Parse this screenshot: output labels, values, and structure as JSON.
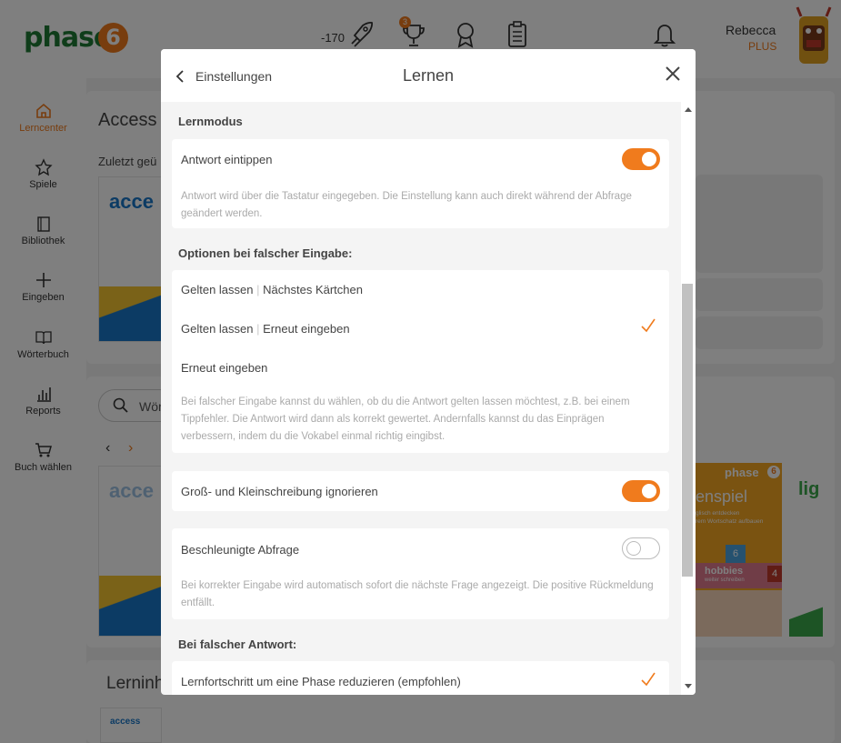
{
  "header": {
    "logo_text": "phase",
    "logo_digit": "6",
    "score": "-170",
    "trophy_badge": "3",
    "user_name": "Rebecca",
    "user_plan": "PLUS"
  },
  "sidebar": {
    "items": [
      {
        "label": "Lerncenter",
        "icon": "home-icon",
        "active": true
      },
      {
        "label": "Spiele",
        "icon": "star-icon"
      },
      {
        "label": "Bibliothek",
        "icon": "book-icon"
      },
      {
        "label": "Eingeben",
        "icon": "plus-icon"
      },
      {
        "label": "Wörterbuch",
        "icon": "open-book-icon"
      },
      {
        "label": "Reports",
        "icon": "bar-chart-icon"
      },
      {
        "label": "Buch wählen",
        "icon": "cart-icon"
      }
    ]
  },
  "background": {
    "heading": "Access",
    "recent": "Zuletzt geü",
    "search_placeholder": "Wör",
    "lerninhalte": "Lerninh",
    "book_label": "acce",
    "book_label_small": "access",
    "card_brand": "phase",
    "card_digit": "6",
    "card_title": "enspiel",
    "card_sub1": "glisch entdecken",
    "card_sub2": "rem Wortschatz aufbauen",
    "card_hobbies": "hobbies",
    "card_hobbies_sub": "weiter schreiben",
    "card_number": "4",
    "card_number2": "6",
    "card_right": "lig"
  },
  "modal": {
    "back_label": "Einstellungen",
    "title": "Lernen",
    "sections": {
      "lernmodus": "Lernmodus",
      "optionen": "Optionen bei falscher Eingabe:",
      "falsche_antwort": "Bei falscher Antwort:"
    },
    "antwort_eintippen": {
      "label": "Antwort eintippen",
      "enabled": true,
      "desc": "Antwort wird über die Tastatur eingegeben. Die Einstellung kann auch direkt während der Abfrage geändert werden."
    },
    "optionen": {
      "option1_a": "Gelten lassen",
      "option1_b": "Nächstes Kärtchen",
      "option2_a": "Gelten lassen",
      "option2_b": "Erneut eingeben",
      "option2_selected": true,
      "option3": "Erneut eingeben",
      "separator": "|",
      "desc": "Bei falscher Eingabe kannst du wählen, ob du die Antwort gelten lassen möchtest, z.B. bei einem Tippfehler. Die Antwort wird dann als korrekt gewertet. Andernfalls kannst du das Einprägen verbessern, indem du die Vokabel einmal richtig eingibst."
    },
    "gross_klein": {
      "label": "Groß- und Kleinschreibung ignorieren",
      "enabled": true
    },
    "beschleunigt": {
      "label": "Beschleunigte Abfrage",
      "enabled": false,
      "desc": "Bei korrekter Eingabe wird automatisch sofort die nächste Frage angezeigt. Die positive Rückmeldung entfällt."
    },
    "lernfortschritt": {
      "label": "Lernfortschritt um eine Phase reduzieren (empfohlen)",
      "selected": true
    }
  },
  "colors": {
    "accent": "#f07b1d",
    "brand_green": "#1e7a34"
  }
}
